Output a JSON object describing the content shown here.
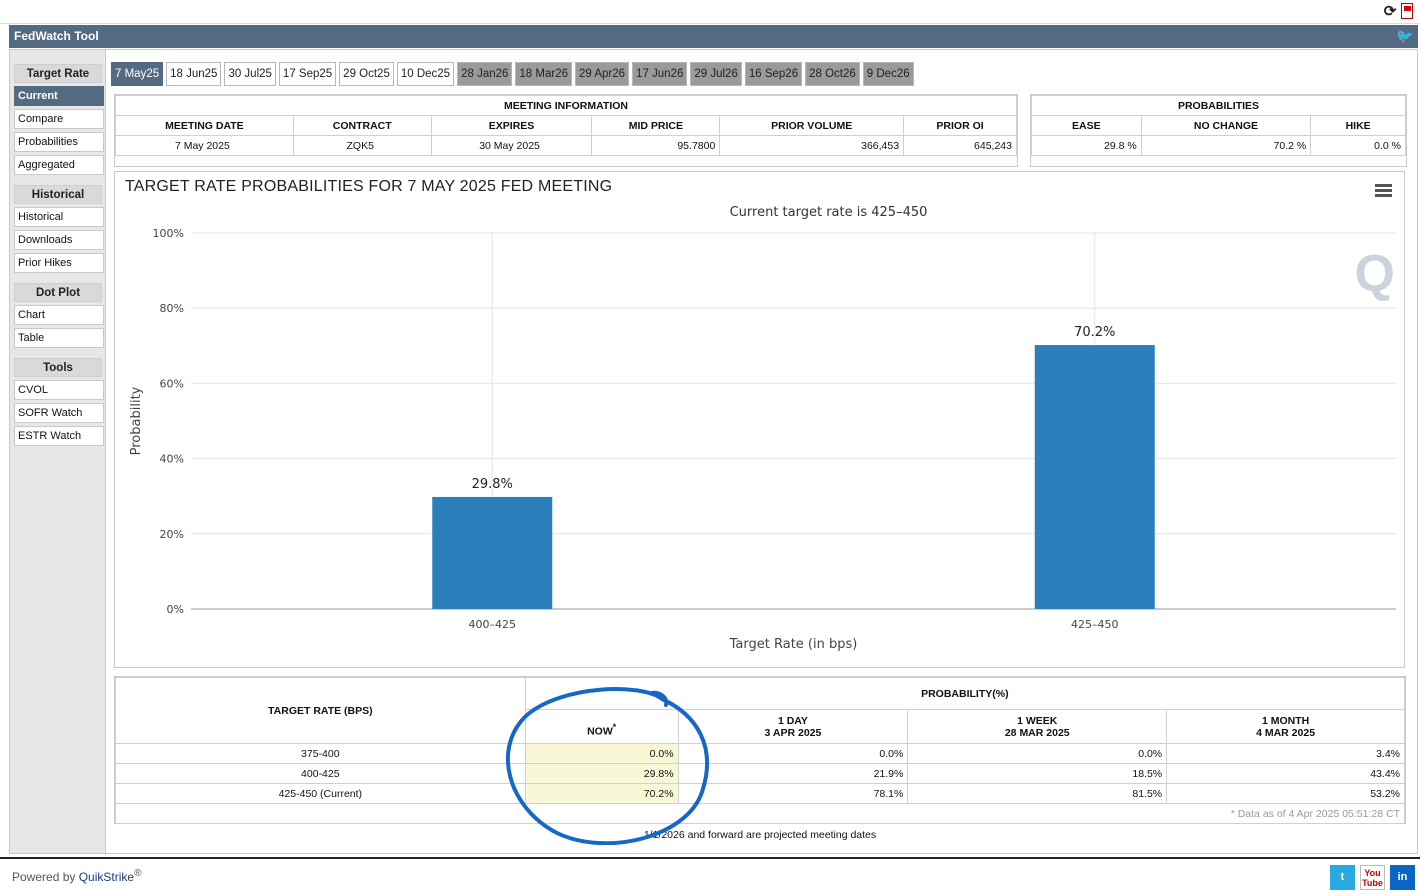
{
  "app": {
    "title": "FedWatch Tool",
    "powered_by": "Powered by",
    "powered_brand": "QuikStrike",
    "trademark": "®"
  },
  "sidebar": {
    "groups": [
      {
        "title": "Target Rate",
        "items": [
          "Current",
          "Compare",
          "Probabilities",
          "Aggregated"
        ],
        "active": 0
      },
      {
        "title": "Historical",
        "items": [
          "Historical",
          "Downloads",
          "Prior Hikes"
        ]
      },
      {
        "title": "Dot Plot",
        "items": [
          "Chart",
          "Table"
        ]
      },
      {
        "title": "Tools",
        "items": [
          "CVOL",
          "SOFR Watch",
          "ESTR Watch"
        ]
      }
    ]
  },
  "tabs": [
    {
      "label": "7 May25",
      "state": "active"
    },
    {
      "label": "18 Jun25",
      "state": "normal"
    },
    {
      "label": "30 Jul25",
      "state": "normal"
    },
    {
      "label": "17 Sep25",
      "state": "normal"
    },
    {
      "label": "29 Oct25",
      "state": "normal"
    },
    {
      "label": "10 Dec25",
      "state": "normal"
    },
    {
      "label": "28 Jan26",
      "state": "future"
    },
    {
      "label": "18 Mar26",
      "state": "future"
    },
    {
      "label": "29 Apr26",
      "state": "future"
    },
    {
      "label": "17 Jun26",
      "state": "future"
    },
    {
      "label": "29 Jul26",
      "state": "future"
    },
    {
      "label": "16 Sep26",
      "state": "future"
    },
    {
      "label": "28 Oct26",
      "state": "future"
    },
    {
      "label": "9 Dec26",
      "state": "future"
    }
  ],
  "meeting_info": {
    "title": "MEETING INFORMATION",
    "headers": [
      "MEETING DATE",
      "CONTRACT",
      "EXPIRES",
      "MID PRICE",
      "PRIOR VOLUME",
      "PRIOR OI"
    ],
    "values": [
      "7 May 2025",
      "ZQK5",
      "30 May 2025",
      "95.7800",
      "366,453",
      "645,243"
    ]
  },
  "probabilities": {
    "title": "PROBABILITIES",
    "headers": [
      "EASE",
      "NO CHANGE",
      "HIKE"
    ],
    "values": [
      "29.8 %",
      "70.2 %",
      "0.0 %"
    ]
  },
  "chart_data": {
    "type": "bar",
    "title": "TARGET RATE PROBABILITIES FOR 7 MAY 2025 FED MEETING",
    "subtitle": "Current target rate is 425–450",
    "categories": [
      "400–425",
      "425–450"
    ],
    "values": [
      29.8,
      70.2
    ],
    "value_labels": [
      "29.8%",
      "70.2%"
    ],
    "xlabel": "Target Rate (in bps)",
    "ylabel": "Probability",
    "ylim": [
      0,
      100
    ],
    "yticks": [
      "0%",
      "20%",
      "40%",
      "60%",
      "80%",
      "100%"
    ],
    "grid": true,
    "bar_color": "#2a7fba",
    "logo_text": "Q"
  },
  "prob_table": {
    "target_header": "TARGET RATE (BPS)",
    "prob_header": "PROBABILITY(%)",
    "columns": [
      {
        "line1": "NOW",
        "marker": "*",
        "line2": ""
      },
      {
        "line1": "1 DAY",
        "line2": "3 APR 2025"
      },
      {
        "line1": "1 WEEK",
        "line2": "28 MAR 2025"
      },
      {
        "line1": "1 MONTH",
        "line2": "4 MAR 2025"
      }
    ],
    "rows": [
      {
        "target": "375-400",
        "values": [
          "0.0%",
          "0.0%",
          "0.0%",
          "3.4%"
        ]
      },
      {
        "target": "400-425",
        "values": [
          "29.8%",
          "21.9%",
          "18.5%",
          "43.4%"
        ]
      },
      {
        "target": "425-450 (Current)",
        "values": [
          "70.2%",
          "78.1%",
          "81.5%",
          "53.2%"
        ]
      }
    ],
    "data_note": "* Data as of 4 Apr 2025 05:51:28 CT",
    "projected_note": "1/1/2026 and forward are projected meeting dates"
  },
  "social": {
    "twitter": "t",
    "youtube": "You Tube",
    "linkedin": "in"
  },
  "colors": {
    "header": "#546a82",
    "active": "#546a82",
    "future_tab": "#9a9a9a",
    "now_highlight": "#f8f8d6",
    "annotation": "#1668c7"
  }
}
